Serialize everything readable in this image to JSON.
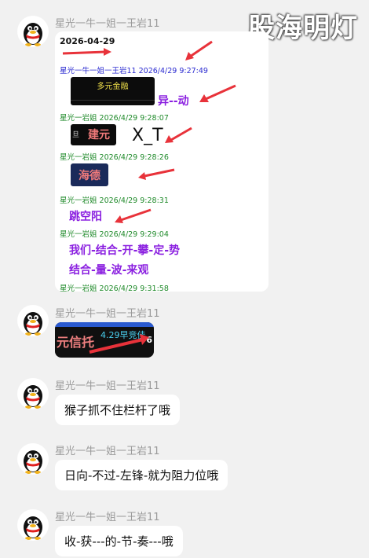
{
  "watermark": "股海明灯",
  "messages": [
    {
      "sender": "星光一牛一姐一王岩11",
      "card": {
        "date": "2026-04-29",
        "lines": [
          {
            "meta": "星光一牛一姐一王岩11 2026/4/29 9:27:49",
            "image_text": "多元金融",
            "tag": "异--动"
          },
          {
            "meta": "星光一岩姐 2026/4/29 9:28:07",
            "image_text": "建元",
            "image_left_text": "旦",
            "tag": "X_T"
          },
          {
            "meta": "星光一岩姐 2026/4/29 9:28:26",
            "image_text": "海德"
          },
          {
            "meta": "星光一岩姐 2026/4/29 9:28:31",
            "tag": "跳空阳"
          },
          {
            "meta": "星光一岩姐 2026/4/29 9:29:04",
            "tags": [
              "我们-结合-开-攀-定-势",
              "结合-量-波-来观"
            ]
          },
          {
            "meta": "星光一岩姐 2026/4/29 9:31:58"
          }
        ]
      }
    },
    {
      "sender": "星光一牛一姐一王岩11",
      "image": {
        "left_text": "元信托",
        "right_text": "4.29早竞佳",
        "digit": "6"
      }
    },
    {
      "sender": "星光一牛一姐一王岩11",
      "text": "猴子抓不住栏杆了哦"
    },
    {
      "sender": "星光一牛一姐一王岩11",
      "text": "日向-不过-左锋-就为阻力位哦"
    },
    {
      "sender": "星光一牛一姐一王岩11",
      "text": "收-获---的-节-奏---哦"
    }
  ],
  "colors": {
    "meta_blue": "#2a2ad0",
    "meta_green": "#1f8a2a",
    "tag_purple": "#8a1fe0",
    "arrow_red": "#e8323a"
  }
}
